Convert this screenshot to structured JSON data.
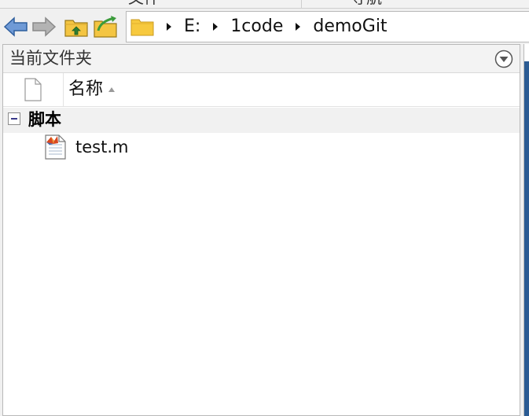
{
  "top_strip": {
    "left_label": "文件",
    "right_label": "导航"
  },
  "toolbar": {
    "back_icon": "back-arrow-icon",
    "forward_icon": "forward-arrow-icon",
    "up_icon": "folder-up-icon",
    "browse_icon": "browse-folder-icon"
  },
  "address": {
    "folder_icon": "folder-icon",
    "crumbs": [
      "E:",
      "1code",
      "demoGit"
    ]
  },
  "panel": {
    "title": "当前文件夹",
    "menu_icon": "chevron-down-circle-icon",
    "columns": {
      "name": "名称"
    },
    "groups": [
      {
        "label": "脚本",
        "files": [
          {
            "name": "test.m",
            "icon": "matlab-script-file-icon"
          }
        ]
      }
    ]
  },
  "colors": {
    "accent_blue": "#2b5b93",
    "nav_arrow_blue": "#4a7fc1",
    "folder_yellow": "#f4c542"
  }
}
